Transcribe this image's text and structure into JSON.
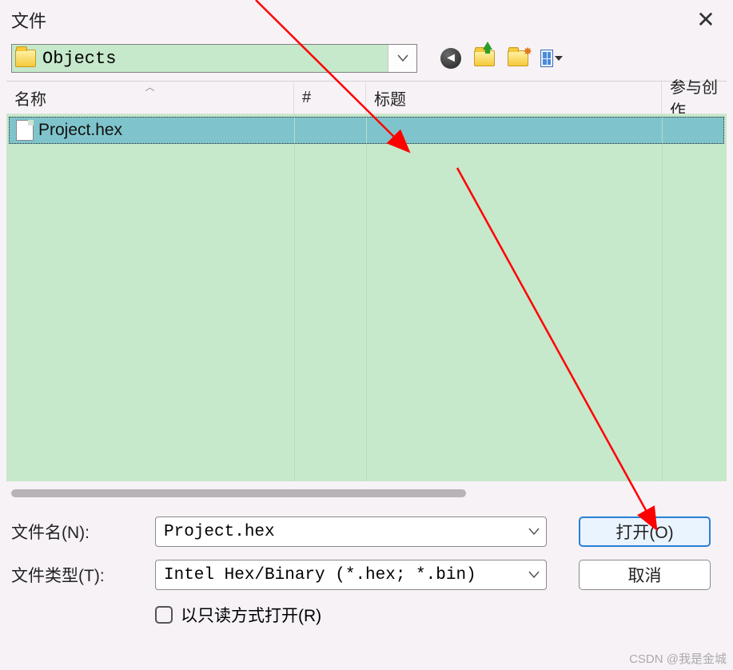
{
  "dialog": {
    "title": "文件"
  },
  "path": {
    "current": "Objects"
  },
  "columns": {
    "name": "名称",
    "hash": "#",
    "title_col": "标题",
    "contrib": "参与创作"
  },
  "files": {
    "selected": "Project.hex"
  },
  "form": {
    "filename_label": "文件名(N):",
    "filename_value": "Project.hex",
    "filetype_label": "文件类型(T):",
    "filetype_value": "Intel Hex/Binary (*.hex; *.bin)",
    "readonly_label": "以只读方式打开(R)"
  },
  "buttons": {
    "open": "打开(O)",
    "cancel": "取消"
  },
  "watermark": "CSDN @我是金城"
}
